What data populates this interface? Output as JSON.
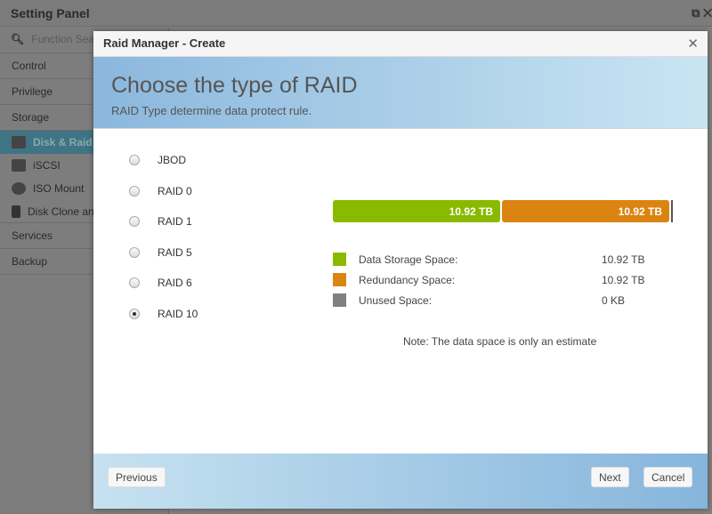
{
  "app": {
    "title": "Setting Panel"
  },
  "sidebar": {
    "search_placeholder": "Function Search",
    "sections": [
      "Control",
      "Privilege",
      "Storage",
      "Services",
      "Backup"
    ],
    "storage_items": [
      {
        "label": "Disk & Raid",
        "icon": "disk-raid-icon",
        "active": true
      },
      {
        "label": "iSCSI",
        "icon": "iscsi-icon"
      },
      {
        "label": "ISO Mount",
        "icon": "iso-mount-icon"
      },
      {
        "label": "Disk Clone and Wipe",
        "icon": "broom-icon"
      }
    ]
  },
  "modal": {
    "title": "Raid Manager - Create",
    "heading": "Choose the type of RAID",
    "subheading": "RAID Type determine data protect rule.",
    "raid_options": [
      "JBOD",
      "RAID 0",
      "RAID 1",
      "RAID 5",
      "RAID 6",
      "RAID 10"
    ],
    "selected": "RAID 10",
    "bar": {
      "data_label": "10.92 TB",
      "redundancy_label": "10.92 TB",
      "data_fraction": 0.5,
      "redundancy_fraction": 0.5
    },
    "legend": [
      {
        "label": "Data Storage Space:",
        "value": "10.92 TB",
        "color": "#8aba00"
      },
      {
        "label": "Redundancy Space:",
        "value": "10.92 TB",
        "color": "#dc8412"
      },
      {
        "label": "Unused Space:",
        "value": "0 KB",
        "color": "#808080"
      }
    ],
    "note": "Note: The data space is only an estimate",
    "buttons": {
      "previous": "Previous",
      "next": "Next",
      "cancel": "Cancel"
    }
  }
}
